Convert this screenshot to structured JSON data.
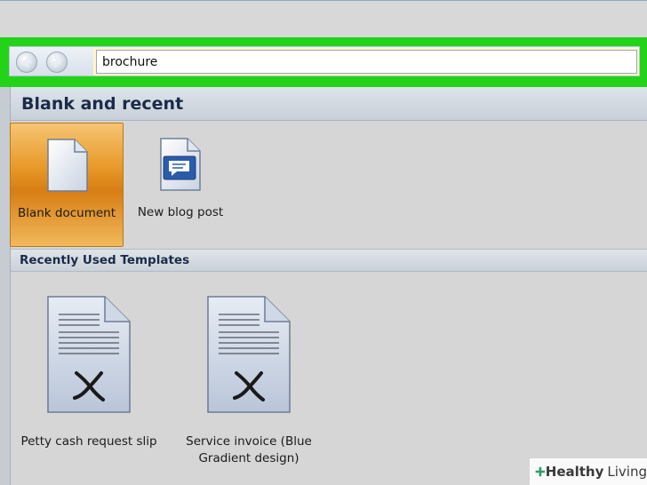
{
  "address": {
    "search_value": "brochure",
    "back_icon": "arrow-left-icon",
    "forward_icon": "arrow-right-icon"
  },
  "blank_section": {
    "title": "Blank and recent",
    "items": [
      {
        "label": "Blank document",
        "icon": "blank-document-icon",
        "selected": true
      },
      {
        "label": "New blog post",
        "icon": "blog-post-icon",
        "selected": false
      }
    ]
  },
  "recent_templates": {
    "title": "Recently Used Templates",
    "items": [
      {
        "label": "Petty cash request slip",
        "icon": "template-document-icon"
      },
      {
        "label": "Service invoice (Blue Gradient design)",
        "icon": "template-document-icon"
      }
    ]
  },
  "watermark": {
    "brand_bold": "Healthy",
    "brand_light": "Living",
    "icon": "plus-cross-icon"
  },
  "colors": {
    "highlight_green": "#22d31a",
    "selected_orange": "#e99a2a",
    "header_text": "#1b2b47"
  }
}
